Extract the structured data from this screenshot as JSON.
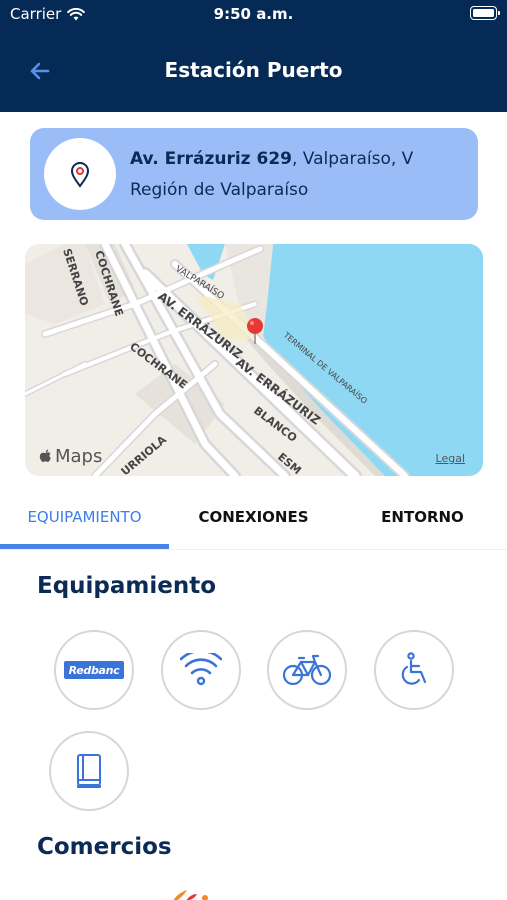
{
  "status_bar": {
    "carrier": "Carrier",
    "time": "9:50 a.m."
  },
  "header": {
    "title": "Estación Puerto"
  },
  "address": {
    "street": "Av. Errázuriz 629",
    "rest": ",  Valparaíso, V Región de Valparaíso"
  },
  "map": {
    "logo": "Maps",
    "legal": "Legal",
    "street_labels": [
      "VALPARAÍSO",
      "COCHRANE",
      "SERRANO",
      "AV. ERRÁZURIZ",
      "AV. ERRÁZURIZ",
      "COCHRANE",
      "BLANCO",
      "TERMINAL DE VALPARAÍSO",
      "URRIOLA",
      "ESM"
    ]
  },
  "tabs": [
    {
      "label": "EQUIPAMIENTO",
      "active": true
    },
    {
      "label": "CONEXIONES",
      "active": false
    },
    {
      "label": "ENTORNO",
      "active": false
    }
  ],
  "sections": {
    "equipamiento": "Equipamiento",
    "comercios": "Comercios"
  },
  "amenities": [
    {
      "name": "redbanc",
      "label": "Redbanc",
      "icon": "redbanc-logo"
    },
    {
      "name": "wifi",
      "icon": "wifi-icon"
    },
    {
      "name": "bicycle",
      "icon": "bicycle-icon"
    },
    {
      "name": "accessibility",
      "icon": "wheelchair-icon"
    },
    {
      "name": "library",
      "icon": "book-icon"
    }
  ],
  "colors": {
    "header": "#062a56",
    "accent": "#4a83e6",
    "address_card": "#9bbdf7",
    "sea": "#8fd8f4",
    "pin": "#e53935"
  }
}
